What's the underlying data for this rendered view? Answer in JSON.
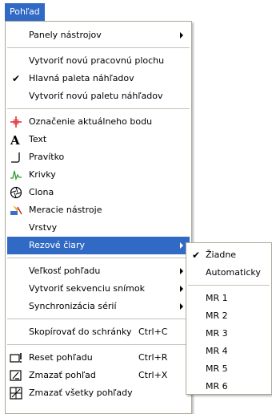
{
  "menubar": {
    "title": "Pohľad"
  },
  "menu": {
    "items": [
      {
        "label": "Panely nástrojov",
        "submenu": true
      },
      {
        "label": "Vytvoriť novú pracovnú plochu"
      },
      {
        "label": "Hlavná paleta náhľadov",
        "checked": true
      },
      {
        "label": "Vytvoriť novú paletu náhľadov"
      },
      {
        "label": "Označenie aktuálneho bodu",
        "icon": "crosshair-icon"
      },
      {
        "label": "Text",
        "icon": "text-icon"
      },
      {
        "label": "Pravítko",
        "icon": "ruler-icon"
      },
      {
        "label": "Krivky",
        "icon": "curve-icon"
      },
      {
        "label": "Clona",
        "icon": "aperture-icon"
      },
      {
        "label": "Meracie nástroje",
        "icon": "measure-tools-icon"
      },
      {
        "label": "Vrstvy"
      },
      {
        "label": "Rezové čiary",
        "submenu": true,
        "highlighted": true
      },
      {
        "label": "Veľkosť pohľadu",
        "submenu": true
      },
      {
        "label": "Vytvoriť sekvenciu snímok",
        "submenu": true
      },
      {
        "label": "Synchronizácia sérií",
        "submenu": true
      },
      {
        "label": "Skopírovať do schránky",
        "shortcut": "Ctrl+C"
      },
      {
        "label": "Reset pohľadu",
        "shortcut": "Ctrl+R",
        "icon": "reset-view-icon"
      },
      {
        "label": "Zmazať pohľad",
        "shortcut": "Ctrl+X",
        "icon": "delete-view-icon"
      },
      {
        "label": "Zmazať všetky pohľady",
        "icon": "delete-all-views-icon"
      }
    ]
  },
  "submenu": {
    "items": [
      {
        "label": "Žiadne",
        "checked": true
      },
      {
        "label": "Automaticky"
      },
      {
        "label": "MR 1"
      },
      {
        "label": "MR 2"
      },
      {
        "label": "MR 3"
      },
      {
        "label": "MR 4"
      },
      {
        "label": "MR 5"
      },
      {
        "label": "MR 6"
      }
    ]
  },
  "colors": {
    "highlight": "#316ac5",
    "menu_border": "#aca899"
  }
}
